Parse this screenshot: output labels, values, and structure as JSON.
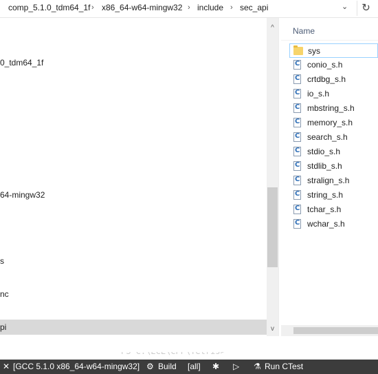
{
  "address_bar": {
    "segments": [
      "comp_5.1.0_tdm64_1f",
      "x86_64-w64-mingw32",
      "include",
      "sec_api"
    ],
    "separator_glyph": "›",
    "dropdown_glyph": "⌄",
    "refresh_glyph": "↻"
  },
  "tree": {
    "nodes": [
      "0_tdm64_1f",
      "64-mingw32",
      "s",
      "nc",
      "pi"
    ]
  },
  "file_list": {
    "column_header": "Name",
    "items": [
      {
        "name": "sys",
        "icon": "folder-icon"
      },
      {
        "name": "conio_s.h",
        "icon": "c-header-file-icon"
      },
      {
        "name": "crtdbg_s.h",
        "icon": "c-header-file-icon"
      },
      {
        "name": "io_s.h",
        "icon": "c-header-file-icon"
      },
      {
        "name": "mbstring_s.h",
        "icon": "c-header-file-icon"
      },
      {
        "name": "memory_s.h",
        "icon": "c-header-file-icon"
      },
      {
        "name": "search_s.h",
        "icon": "c-header-file-icon"
      },
      {
        "name": "stdio_s.h",
        "icon": "c-header-file-icon"
      },
      {
        "name": "stdlib_s.h",
        "icon": "c-header-file-icon"
      },
      {
        "name": "stralign_s.h",
        "icon": "c-header-file-icon"
      },
      {
        "name": "string_s.h",
        "icon": "c-header-file-icon"
      },
      {
        "name": "tchar_s.h",
        "icon": "c-header-file-icon"
      },
      {
        "name": "wchar_s.h",
        "icon": "c-header-file-icon"
      }
    ],
    "file_icon_letter": "C"
  },
  "terminal": {
    "prompt_text": "PS C:\\ECL\\CPP\\Tetris> "
  },
  "status_bar": {
    "kit_label": "[GCC 5.1.0 x86_64-w64-mingw32]",
    "build_label": "Build",
    "target_label": "[all]",
    "run_ctest_label": "Run CTest",
    "icons": {
      "tools": "✕",
      "gear": "⚙",
      "debug": "✱",
      "play": "▷",
      "flask": "⚗"
    }
  },
  "colors": {
    "status_bar_bg": "#3c3c3c",
    "selection_border": "#99d1ff",
    "folder": "#f7d46a",
    "header_text": "#4b5b75"
  }
}
